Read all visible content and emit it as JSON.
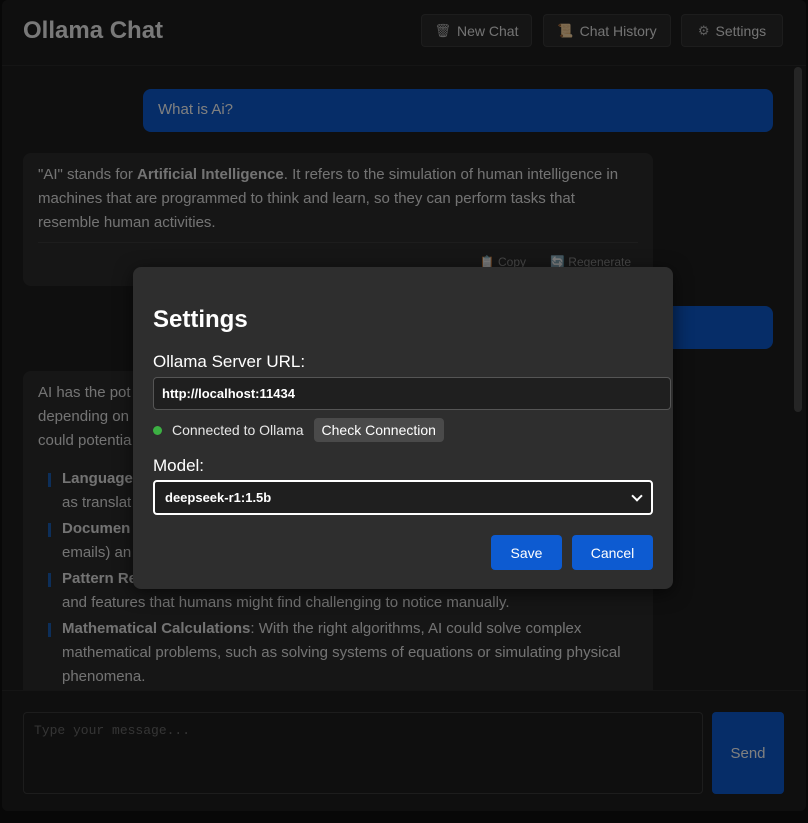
{
  "app": {
    "title": "Ollama Chat"
  },
  "header": {
    "buttons": [
      {
        "icon": "trash-icon",
        "label": "New Chat"
      },
      {
        "icon": "scroll-icon",
        "label": "Chat History"
      },
      {
        "icon": "gear-icon",
        "label": "Settings"
      }
    ]
  },
  "messages": {
    "user1": "What is Ai?",
    "assistant1": {
      "pre": "\"AI\" stands for ",
      "bold": "Artificial Intelligence",
      "post": ". It refers to the simulation of human intelligence in machines that are programmed to think and learn, so they can perform tasks that resemble human activities.",
      "copy_label": "Copy",
      "regen_label": "Regenerate"
    },
    "assistant2": {
      "intro_line1": "AI has the pot",
      "intro_line2": "depending on",
      "intro_line3": "could potentia",
      "items": [
        {
          "title": "Language",
          "line2": "as translat"
        },
        {
          "title": "Documen",
          "line2": "emails) an"
        },
        {
          "title": "Pattern Re",
          "line2": "and features that humans might find challenging to notice manually."
        },
        {
          "title": "Mathematical Calculations",
          "text": ": With the right algorithms, AI could solve complex mathematical problems, such as solving systems of equations or simulating physical phenomena."
        }
      ]
    }
  },
  "composer": {
    "placeholder": "Type your message...",
    "send_label": "Send"
  },
  "settings": {
    "title": "Settings",
    "server_label": "Ollama Server URL:",
    "server_value": "http://localhost:11434",
    "status_text": "Connected to Ollama",
    "check_label": "Check Connection",
    "model_label": "Model:",
    "model_value": "deepseek-r1:1.5b",
    "save_label": "Save",
    "cancel_label": "Cancel"
  },
  "colors": {
    "accent": "#0d5bd1",
    "status_ok": "#3cb043"
  }
}
